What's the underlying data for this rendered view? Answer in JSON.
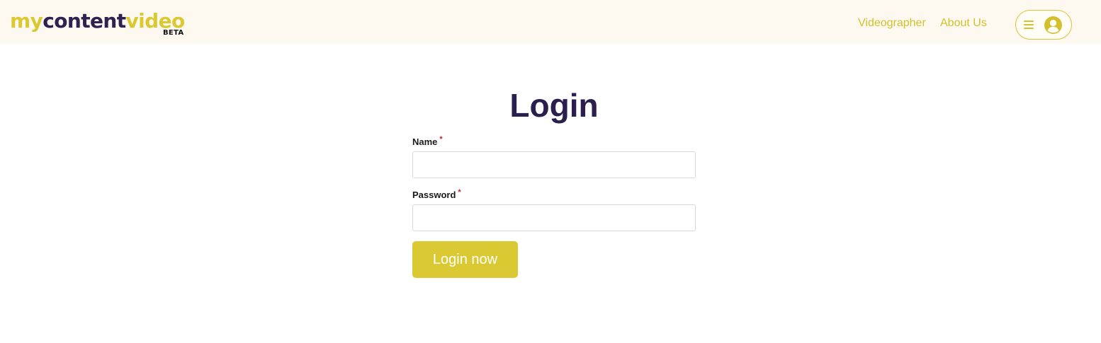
{
  "header": {
    "logo": {
      "part1": "my",
      "part2": "content",
      "part3": "video",
      "badge": "BETA"
    },
    "nav": [
      {
        "label": "Videographer"
      },
      {
        "label": "About Us"
      }
    ],
    "user_menu": {
      "icons": [
        "hamburger-icon",
        "user-avatar-icon"
      ]
    }
  },
  "login": {
    "title": "Login",
    "fields": [
      {
        "label": "Name",
        "required_mark": "*",
        "value": "",
        "placeholder": ""
      },
      {
        "label": "Password",
        "required_mark": "*",
        "value": "",
        "placeholder": ""
      }
    ],
    "submit_label": "Login now"
  },
  "colors": {
    "brand_yellow": "#dbc934",
    "brand_navy": "#2b1f4d",
    "header_bg": "#fdf9f0",
    "required_red": "#c0262c"
  }
}
